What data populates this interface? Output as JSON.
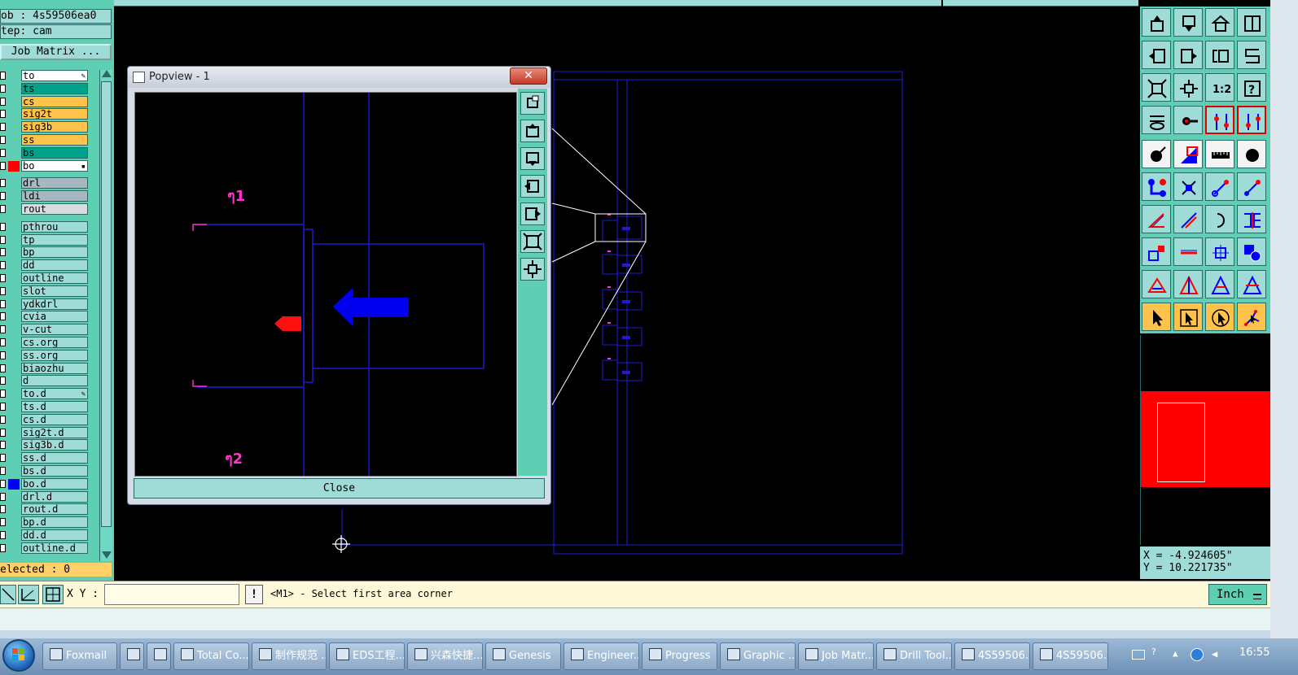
{
  "left_panel": {
    "job_label": "ob : 4s59506ea0",
    "step_label": "tep: cam",
    "matrix_button": "Job Matrix ...",
    "selected_text": "elected : 0"
  },
  "layers": [
    {
      "name": "to",
      "color": "#ffffff",
      "edit": true
    },
    {
      "name": "ts",
      "color": "#00a38a"
    },
    {
      "name": "cs",
      "color": "#ffc24a"
    },
    {
      "name": "sig2t",
      "color": "#ffc24a"
    },
    {
      "name": "sig3b",
      "color": "#ffc24a"
    },
    {
      "name": "ss",
      "color": "#ffc24a"
    },
    {
      "name": "bs",
      "color": "#00a38a"
    },
    {
      "name": "bo",
      "color": "#ffffff",
      "swatch": "#ff0000",
      "mark": true
    },
    {
      "name": "drl",
      "color": "#a8b8c0",
      "gap": true
    },
    {
      "name": "ldi",
      "color": "#a8b8c0"
    },
    {
      "name": "rout",
      "color": "#d8dde0"
    },
    {
      "name": "pthrou",
      "color": "#9fdcd8",
      "gap": true
    },
    {
      "name": "tp",
      "color": "#9fdcd8"
    },
    {
      "name": "bp",
      "color": "#9fdcd8"
    },
    {
      "name": "dd",
      "color": "#9fdcd8"
    },
    {
      "name": "outline",
      "color": "#9fdcd8"
    },
    {
      "name": "slot",
      "color": "#9fdcd8"
    },
    {
      "name": "ydkdrl",
      "color": "#9fdcd8"
    },
    {
      "name": "cvia",
      "color": "#9fdcd8"
    },
    {
      "name": "v-cut",
      "color": "#9fdcd8"
    },
    {
      "name": "cs.org",
      "color": "#9fdcd8"
    },
    {
      "name": "ss.org",
      "color": "#9fdcd8"
    },
    {
      "name": "biaozhu",
      "color": "#9fdcd8"
    },
    {
      "name": "d",
      "color": "#9fdcd8"
    },
    {
      "name": "to.d",
      "color": "#9fdcd8",
      "edit": true
    },
    {
      "name": "ts.d",
      "color": "#9fdcd8"
    },
    {
      "name": "cs.d",
      "color": "#9fdcd8"
    },
    {
      "name": "sig2t.d",
      "color": "#9fdcd8"
    },
    {
      "name": "sig3b.d",
      "color": "#9fdcd8"
    },
    {
      "name": "ss.d",
      "color": "#9fdcd8"
    },
    {
      "name": "bs.d",
      "color": "#9fdcd8"
    },
    {
      "name": "bo.d",
      "color": "#9fdcd8",
      "swatch": "#0000ff"
    },
    {
      "name": "drl.d",
      "color": "#9fdcd8"
    },
    {
      "name": "rout.d",
      "color": "#9fdcd8"
    },
    {
      "name": "bp.d",
      "color": "#9fdcd8"
    },
    {
      "name": "dd.d",
      "color": "#9fdcd8"
    },
    {
      "name": "outline.d",
      "color": "#9fdcd8"
    }
  ],
  "popview": {
    "title": "Popview - 1",
    "close_x": "✕",
    "close_button": "Close",
    "text_top": "ๆ1",
    "text_bottom": "ๆ2"
  },
  "coords": {
    "x_text": "X = -4.924605\"",
    "y_text": "Y = 10.221735\""
  },
  "command": {
    "xy_label": "X Y :",
    "xy_value": "",
    "prompt": "<M1> - Select first area corner",
    "units": "Inch"
  },
  "taskbar": {
    "items": [
      {
        "label": "Foxmail",
        "icon": "foxmail-icon"
      },
      {
        "label": "",
        "icon": "app-icon"
      },
      {
        "label": "",
        "icon": "doc-icon"
      },
      {
        "label": "Total Co...",
        "icon": "totalcmd-icon"
      },
      {
        "label": "制作规范 ...",
        "icon": "window-icon"
      },
      {
        "label": "EDS工程...",
        "icon": "eds-icon"
      },
      {
        "label": "兴森快捷...",
        "icon": "star-icon"
      },
      {
        "label": "Genesis",
        "icon": "genesis-icon"
      },
      {
        "label": "Engineer...",
        "icon": "window-icon"
      },
      {
        "label": "Progress",
        "icon": "window-icon"
      },
      {
        "label": "Graphic ...",
        "icon": "window-icon"
      },
      {
        "label": "Job Matr...",
        "icon": "window-icon"
      },
      {
        "label": "Drill Tool...",
        "icon": "window-icon"
      },
      {
        "label": "4S59506...",
        "icon": "excel-icon"
      },
      {
        "label": "4S59506...",
        "icon": "excel-icon"
      }
    ],
    "clock": "16:55"
  },
  "colors": {
    "panel": "#5fcfb4",
    "button": "#9fdcd8",
    "outline_blue": "#1d1dd8",
    "highlight_red": "#ff0000"
  }
}
